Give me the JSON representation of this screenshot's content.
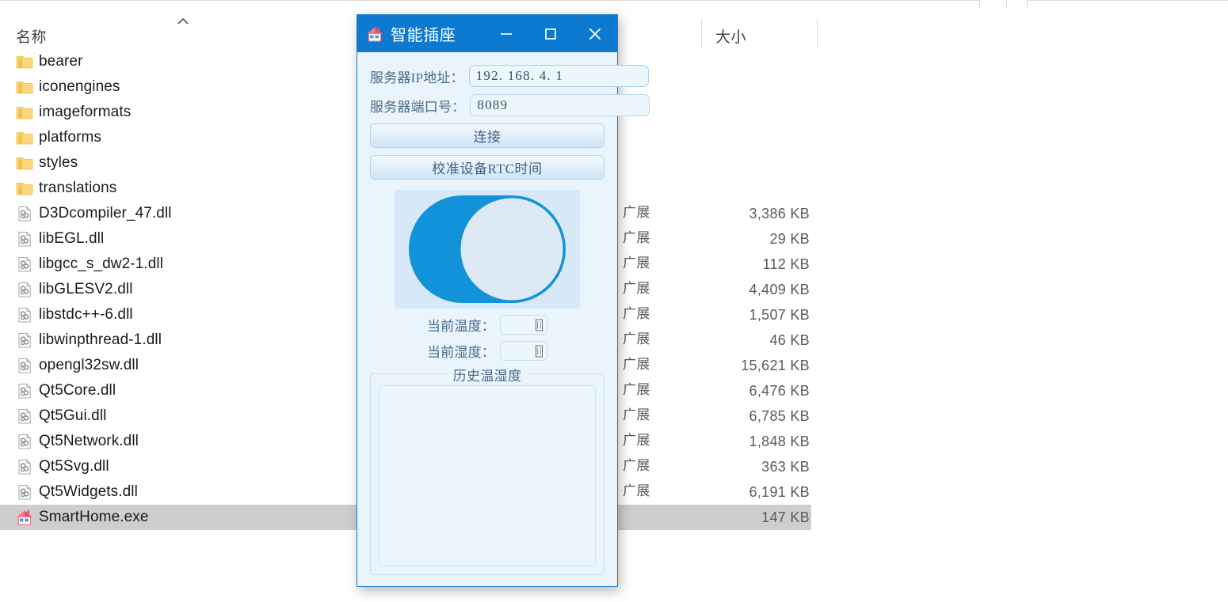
{
  "explorer": {
    "columns": {
      "name": "名称",
      "size": "大小"
    },
    "sort_indicator": "ascending-chevron",
    "rows": [
      {
        "name": "bearer",
        "icon": "folder-icon",
        "type": "",
        "size": ""
      },
      {
        "name": "iconengines",
        "icon": "folder-icon",
        "type": "",
        "size": ""
      },
      {
        "name": "imageformats",
        "icon": "folder-icon",
        "type": "",
        "size": ""
      },
      {
        "name": "platforms",
        "icon": "folder-icon",
        "type": "",
        "size": ""
      },
      {
        "name": "styles",
        "icon": "folder-icon",
        "type": "",
        "size": ""
      },
      {
        "name": "translations",
        "icon": "folder-icon",
        "type": "",
        "size": ""
      },
      {
        "name": "D3Dcompiler_47.dll",
        "icon": "dll-icon",
        "type": "广展",
        "size": "3,386 KB"
      },
      {
        "name": "libEGL.dll",
        "icon": "dll-icon",
        "type": "广展",
        "size": "29 KB"
      },
      {
        "name": "libgcc_s_dw2-1.dll",
        "icon": "dll-icon",
        "type": "广展",
        "size": "112 KB"
      },
      {
        "name": "libGLESV2.dll",
        "icon": "dll-icon",
        "type": "广展",
        "size": "4,409 KB"
      },
      {
        "name": "libstdc++-6.dll",
        "icon": "dll-icon",
        "type": "广展",
        "size": "1,507 KB"
      },
      {
        "name": "libwinpthread-1.dll",
        "icon": "dll-icon",
        "type": "广展",
        "size": "46 KB"
      },
      {
        "name": "opengl32sw.dll",
        "icon": "dll-icon",
        "type": "广展",
        "size": "15,621 KB"
      },
      {
        "name": "Qt5Core.dll",
        "icon": "dll-icon",
        "type": "广展",
        "size": "6,476 KB"
      },
      {
        "name": "Qt5Gui.dll",
        "icon": "dll-icon",
        "type": "广展",
        "size": "6,785 KB"
      },
      {
        "name": "Qt5Network.dll",
        "icon": "dll-icon",
        "type": "广展",
        "size": "1,848 KB"
      },
      {
        "name": "Qt5Svg.dll",
        "icon": "dll-icon",
        "type": "广展",
        "size": "363 KB"
      },
      {
        "name": "Qt5Widgets.dll",
        "icon": "dll-icon",
        "type": "广展",
        "size": "6,191 KB"
      },
      {
        "name": "SmartHome.exe",
        "icon": "house-app-icon",
        "type": "",
        "size": "147 KB",
        "selected": true
      }
    ]
  },
  "dialog": {
    "title": "智能插座",
    "icon": "house-app-icon",
    "window_buttons": {
      "minimize": "minimize-icon",
      "maximize": "maximize-icon",
      "close": "close-icon"
    },
    "fields": {
      "ip_label": "服务器IP地址：",
      "ip_value": "192. 168. 4. 1",
      "ip_placeholder": "",
      "port_label": "服务器端口号：",
      "port_value": "8089",
      "port_placeholder": ""
    },
    "buttons": {
      "connect": "连接",
      "sync_rtc": "校准设备RTC时间"
    },
    "toggle": {
      "state": "on",
      "track_color": "#1192d9",
      "knob_color": "#dde9f5",
      "panel_color": "#d7e9f8"
    },
    "readouts": {
      "temperature_label": "当前温度：",
      "temperature_value": "",
      "humidity_label": "当前湿度：",
      "humidity_value": ""
    },
    "history": {
      "title": "历史温湿度",
      "items": []
    }
  },
  "colors": {
    "titlebar": "#0b7ad0",
    "dialog_bg": "#eaf4fc",
    "accent": "#1192d9",
    "selection": "#cecece"
  }
}
